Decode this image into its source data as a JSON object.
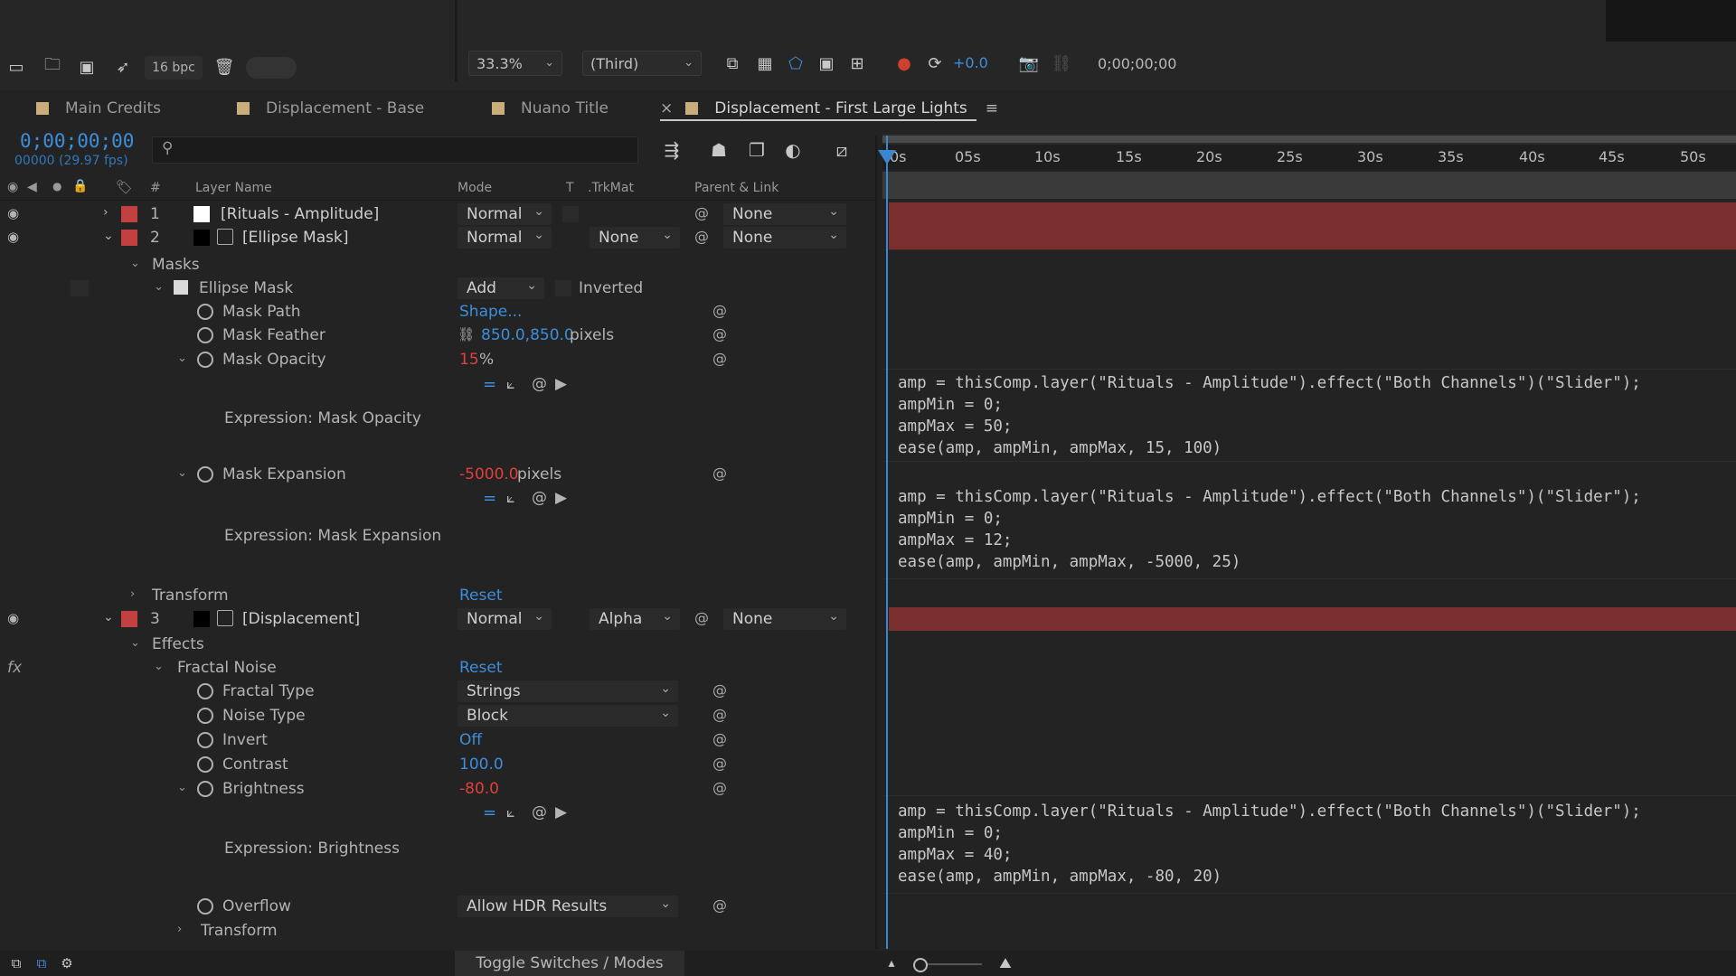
{
  "toolbar": {
    "bpc": "16 bpc",
    "zoom": "33.3%",
    "view": "(Third)",
    "exposure": "+0.0",
    "timecode": "0;00;00;00"
  },
  "tabs": [
    {
      "label": "Main Credits"
    },
    {
      "label": "Displacement - Base"
    },
    {
      "label": "Nuano Title"
    },
    {
      "label": "Displacement - First Large Lights",
      "close": "×",
      "menu": "≡"
    }
  ],
  "timeline": {
    "timecode": "0;00;00;00",
    "fps": "00000 (29.97 fps)",
    "search_placeholder": ""
  },
  "columns": {
    "num": "#",
    "layer_name": "Layer Name",
    "mode": "Mode",
    "t": "T",
    "trkmat": ".TrkMat",
    "parent": "Parent & Link"
  },
  "ruler_ticks": [
    "0s",
    "05s",
    "10s",
    "15s",
    "20s",
    "25s",
    "30s",
    "35s",
    "40s",
    "45s",
    "50s"
  ],
  "layers": {
    "l1": {
      "num": "1",
      "name": "[Rituals - Amplitude]",
      "mode": "Normal",
      "parent": "None"
    },
    "l2": {
      "num": "2",
      "name": "[Ellipse Mask]",
      "mode": "Normal",
      "trkmat": "None",
      "parent": "None"
    },
    "l3": {
      "num": "3",
      "name": "[Displacement]",
      "mode": "Normal",
      "trkmat": "Alpha",
      "parent": "None"
    }
  },
  "masks": {
    "group": "Masks",
    "mask_name": "Ellipse Mask",
    "mode": "Add",
    "inverted": "Inverted",
    "path_label": "Mask Path",
    "path_value": "Shape...",
    "feather_label": "Mask Feather",
    "feather_value": "850.0,850.0",
    "feather_unit": "pixels",
    "opacity_label": "Mask Opacity",
    "opacity_value": "15",
    "opacity_unit": "%",
    "expr_opacity": "Expression: Mask Opacity",
    "expansion_label": "Mask Expansion",
    "expansion_value": "-5000.0",
    "expansion_unit": "pixels",
    "expr_expansion": "Expression: Mask Expansion",
    "transform_label": "Transform",
    "transform_reset": "Reset"
  },
  "effects": {
    "group": "Effects",
    "fx": "fx",
    "fractal_noise": "Fractal Noise",
    "fractal_reset": "Reset",
    "fractal_type_label": "Fractal Type",
    "fractal_type_value": "Strings",
    "noise_type_label": "Noise Type",
    "noise_type_value": "Block",
    "invert_label": "Invert",
    "invert_value": "Off",
    "contrast_label": "Contrast",
    "contrast_value": "100.0",
    "brightness_label": "Brightness",
    "brightness_value": "-80.0",
    "expr_brightness": "Expression: Brightness",
    "overflow_label": "Overflow",
    "overflow_value": "Allow HDR Results",
    "transform_label": "Transform"
  },
  "expressions": {
    "opacity": "amp = thisComp.layer(\"Rituals - Amplitude\").effect(\"Both Channels\")(\"Slider\");\nampMin = 0;\nampMax = 50;\nease(amp, ampMin, ampMax, 15, 100)",
    "expansion": "amp = thisComp.layer(\"Rituals - Amplitude\").effect(\"Both Channels\")(\"Slider\");\nampMin = 0;\nampMax = 12;\nease(amp, ampMin, ampMax, -5000, 25)",
    "brightness": "amp = thisComp.layer(\"Rituals - Amplitude\").effect(\"Both Channels\")(\"Slider\");\nampMin = 0;\nampMax = 40;\nease(amp, ampMin, ampMax, -80, 20)"
  },
  "bottom": {
    "toggle": "Toggle Switches / Modes"
  },
  "colors": {
    "accent_blue": "#3d8edb",
    "value_red": "#e0403a",
    "layer_bar": "#7a2e2e",
    "label_red": "#c24040",
    "tab_swatch": "#c9ad7a"
  }
}
